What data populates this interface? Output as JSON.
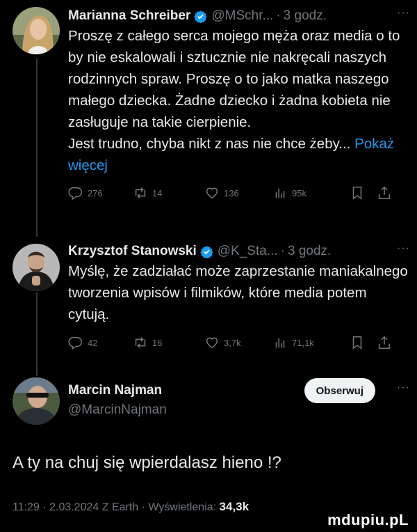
{
  "tweets": [
    {
      "name": "Marianna Schreiber",
      "handle": "@MSchr...",
      "time": "3 godz.",
      "body_lines": [
        "Proszę z całego serca mojego męża oraz media o to by nie eskalowali i sztucznie nie nakręcali naszych rodzinnych spraw. Proszę o to jako matka naszego małego dziecka. Żadne dziecko i żadna kobieta nie zasługuje na takie cierpienie.",
        "Jest trudno, chyba nikt z nas nie chce żeby..."
      ],
      "show_more": "Pokaż więcej",
      "replies": "276",
      "reposts": "14",
      "likes": "136",
      "views": "95k"
    },
    {
      "name": "Krzysztof Stanowski",
      "handle": "@K_Sta...",
      "time": "3 godz.",
      "body_lines": [
        "Myślę, że zadziałać może zaprzestanie maniakalnego tworzenia wpisów i filmików, które media potem cytują."
      ],
      "replies": "42",
      "reposts": "16",
      "likes": "3,7k",
      "views": "71,1k"
    }
  ],
  "dots": "···",
  "separator": "·",
  "main": {
    "name": "Marcin Najman",
    "handle": "@MarcinNajman",
    "follow_label": "Obserwuj",
    "text": "A ty na chuj się wpierdalasz hieno !?",
    "time": "11:29",
    "date": "2.03.2024 Z Earth",
    "views_label": "Wyświetlenia:",
    "views": "34,3k"
  },
  "watermark": "mdupiu.pL",
  "colors": {
    "background": "#000000",
    "text": "#e7e9ea",
    "muted": "#71767b",
    "link": "#1d9bf0",
    "verified": "#1d9bf0"
  }
}
